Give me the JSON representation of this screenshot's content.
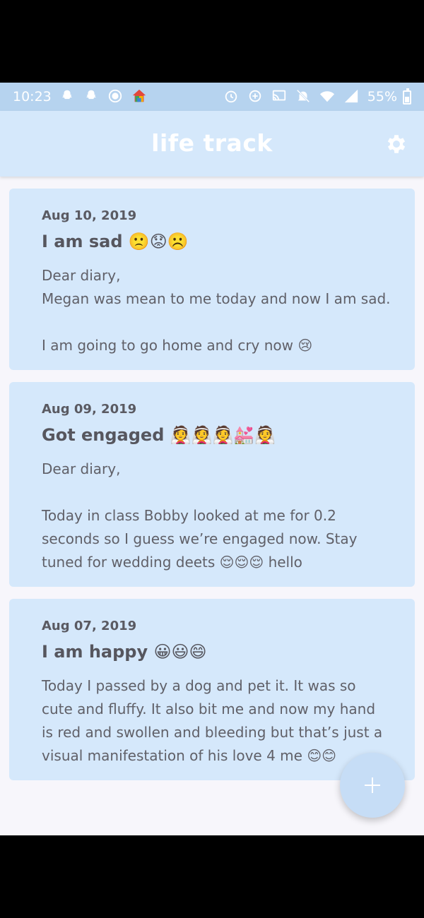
{
  "status_bar": {
    "time": "10:23",
    "battery": "55%",
    "left_icons": [
      "snapchat-icon",
      "snapchat-icon",
      "record-icon",
      "home-app-icon"
    ],
    "right_icons": [
      "alarm-icon",
      "data-saver-icon",
      "cast-icon",
      "mute-icon",
      "wifi-icon",
      "signal-icon"
    ]
  },
  "app_bar": {
    "title": "life track",
    "settings_icon": "gear-icon"
  },
  "entries": [
    {
      "date": "Aug 10, 2019",
      "title": "I am sad 🙁😟☹️",
      "body": "Dear diary,\nMegan was mean to me today and now I am sad.\n\nI am going to go home and cry now 😢"
    },
    {
      "date": "Aug 09, 2019",
      "title": "Got engaged 👰👰👰💒👰",
      "body": "Dear diary,\n\nToday in class Bobby looked at me for 0.2 seconds so I guess we’re engaged now. Stay tuned for wedding deets 😌😌😌 hello"
    },
    {
      "date": "Aug 07, 2019",
      "title": "I am happy 😀😃😄",
      "body": "Today I passed by a dog and pet it. It was so cute and fluffy. It also bit me and now my hand is red and swollen and bleeding but that’s just a visual manifestation of his love 4 me 😊😊"
    }
  ],
  "fab": {
    "icon": "plus-icon"
  },
  "colors": {
    "status_bar": "#b6d3ef",
    "app_bar": "#d5e8fb",
    "card": "#d5e8fb",
    "background": "#f7f6fb",
    "fab": "#c6ddf6"
  }
}
